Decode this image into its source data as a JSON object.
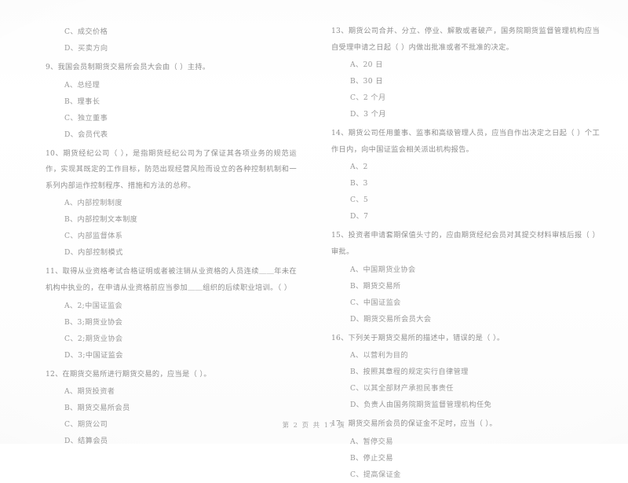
{
  "document": {
    "type": "scanned-exam-paper",
    "footer": "第 2 页  共 17 页",
    "page_number": "2",
    "total_pages": "17"
  },
  "columns": {
    "left": {
      "continued_options": [
        {
          "label": "C、",
          "text": "成交价格"
        },
        {
          "label": "D、",
          "text": "买卖方向"
        }
      ],
      "questions": [
        {
          "number": "9、",
          "stem": "我国会员制期货交易所会员大会由（    ）主持。",
          "options": [
            {
              "label": "A、",
              "text": "总经理"
            },
            {
              "label": "B、",
              "text": "理事长"
            },
            {
              "label": "C、",
              "text": "独立董事"
            },
            {
              "label": "D、",
              "text": "会员代表"
            }
          ]
        },
        {
          "number": "10、",
          "stem": "期货经纪公司（    ），是指期货经纪公司为了保证其各项业务的规范运作，实现其既定的工作目标，防范出现经营风险而设立的各种控制机制和一系列内部运作控制程序、措施和方法的总称。",
          "options": [
            {
              "label": "A、",
              "text": "内部控制制度"
            },
            {
              "label": "B、",
              "text": "内部控制文本制度"
            },
            {
              "label": "C、",
              "text": "内部监督体系"
            },
            {
              "label": "D、",
              "text": "内部控制模式"
            }
          ]
        },
        {
          "number": "11、",
          "stem": "取得从业资格考试合格证明或者被注销从业资格的人员连续＿＿年未在机构中执业的，在申请从业资格前应当参加＿＿组织的后续职业培训。（    ）",
          "options": [
            {
              "label": "A、",
              "text": "2;中国证监会"
            },
            {
              "label": "B、",
              "text": "3;期货业协会"
            },
            {
              "label": "C、",
              "text": "2;期货业协会"
            },
            {
              "label": "D、",
              "text": "3;中国证监会"
            }
          ]
        },
        {
          "number": "12、",
          "stem": "在期货交易所进行期货交易的，应当是（    ）。",
          "options": [
            {
              "label": "A、",
              "text": "期货投资者"
            },
            {
              "label": "B、",
              "text": "期货交易所会员"
            },
            {
              "label": "C、",
              "text": "期货公司"
            },
            {
              "label": "D、",
              "text": "结算会员"
            }
          ]
        }
      ]
    },
    "right": {
      "questions": [
        {
          "number": "13、",
          "stem": "期货公司合并、分立、停业、解散或者破产，国务院期货监督管理机构应当自受理申请之日起（    ）内做出批准或者不批准的决定。",
          "options": [
            {
              "label": "A、",
              "text": "20 日"
            },
            {
              "label": "B、",
              "text": "30 日"
            },
            {
              "label": "C、",
              "text": "2 个月"
            },
            {
              "label": "D、",
              "text": "3 个月"
            }
          ]
        },
        {
          "number": "14、",
          "stem": "期货公司任用董事、监事和高级管理人员，应当自作出决定之日起（    ）个工作日内，向中国证监会相关派出机构报告。",
          "options": [
            {
              "label": "A、",
              "text": "2"
            },
            {
              "label": "B、",
              "text": "3"
            },
            {
              "label": "C、",
              "text": "5"
            },
            {
              "label": "D、",
              "text": "7"
            }
          ]
        },
        {
          "number": "15、",
          "stem": "投资者申请套期保值头寸的，应由期货经纪会员对其提交材料审核后报（    ）审批。",
          "options": [
            {
              "label": "A、",
              "text": "中国期货业协会"
            },
            {
              "label": "B、",
              "text": "期货交易所"
            },
            {
              "label": "C、",
              "text": "中国证监会"
            },
            {
              "label": "D、",
              "text": "期货交易所会员大会"
            }
          ]
        },
        {
          "number": "16、",
          "stem": "下列关于期货交易所的描述中，错误的是（    ）。",
          "options": [
            {
              "label": "A、",
              "text": "以营利为目的"
            },
            {
              "label": "B、",
              "text": "按照其章程的规定实行自律管理"
            },
            {
              "label": "C、",
              "text": "以其全部财产承担民事责任"
            },
            {
              "label": "D、",
              "text": "负责人由国务院期货监督管理机构任免"
            }
          ]
        },
        {
          "number": "17、",
          "stem": "期货交易所会员的保证金不足时，应当（    ）。",
          "options": [
            {
              "label": "A、",
              "text": "暂停交易"
            },
            {
              "label": "B、",
              "text": "停止交易"
            },
            {
              "label": "C、",
              "text": "提高保证金"
            }
          ]
        }
      ]
    }
  }
}
